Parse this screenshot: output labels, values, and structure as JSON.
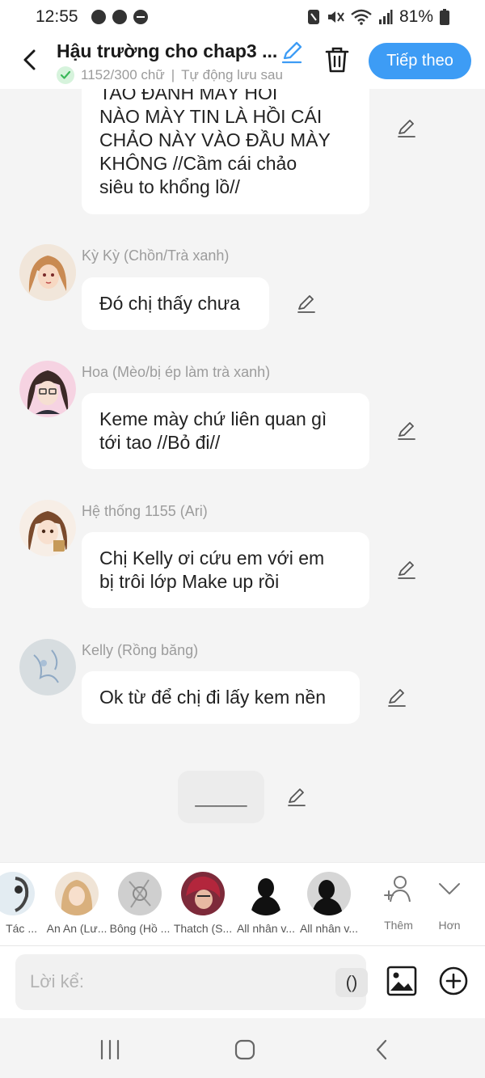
{
  "status_bar": {
    "time": "12:55",
    "battery": "81%"
  },
  "header": {
    "title": "Hậu trường cho chap3 ...",
    "word_count": "1152/300 chữ",
    "separator": "|",
    "autosave": "Tự động lưu sau",
    "next_label": "Tiếp theo"
  },
  "messages": [
    {
      "text_lines": [
        "TAO ĐÁNH MÀY HỎI",
        "NÀO MÀY TIN LÀ HỒI CÁI",
        "CHẢO NÀY VÀO ĐẦU MÀY",
        "KHÔNG //Cầm cái chảo",
        "siêu to khổng lồ//"
      ]
    },
    {
      "speaker": "Kỳ Kỳ (Chồn/Trà xanh)",
      "text_lines": [
        "Đó chị thấy chưa"
      ]
    },
    {
      "speaker": "Hoa (Mèo/bị ép làm trà xanh)",
      "text_lines": [
        "Keme mày chứ liên quan gì",
        "tới tao //Bỏ đi//"
      ]
    },
    {
      "speaker": "Hệ thống 1155 (Ari)",
      "text_lines": [
        "Chị Kelly ơi cứu em với em",
        "bị trôi lớp Make up rồi"
      ]
    },
    {
      "speaker": "Kelly (Rồng băng)",
      "text_lines": [
        "Ok từ để chị đi lấy kem nền"
      ]
    },
    {
      "text_lines": [
        "_____"
      ]
    }
  ],
  "characters": [
    {
      "name": "Tác ..."
    },
    {
      "name": "An An (Lư..."
    },
    {
      "name": "Bông (Hồ ..."
    },
    {
      "name": "Thatch (S..."
    },
    {
      "name": "All nhân v..."
    },
    {
      "name": "All nhân v..."
    }
  ],
  "strip_buttons": {
    "add_label": "Thêm",
    "more_label": "Hơn"
  },
  "composer": {
    "placeholder": "Lời kể:",
    "paren_label": "()"
  },
  "colors": {
    "accent": "#3d9cf5",
    "background": "#f4f4f4",
    "bubble": "#ffffff",
    "muted_text": "#9c9c9c"
  }
}
